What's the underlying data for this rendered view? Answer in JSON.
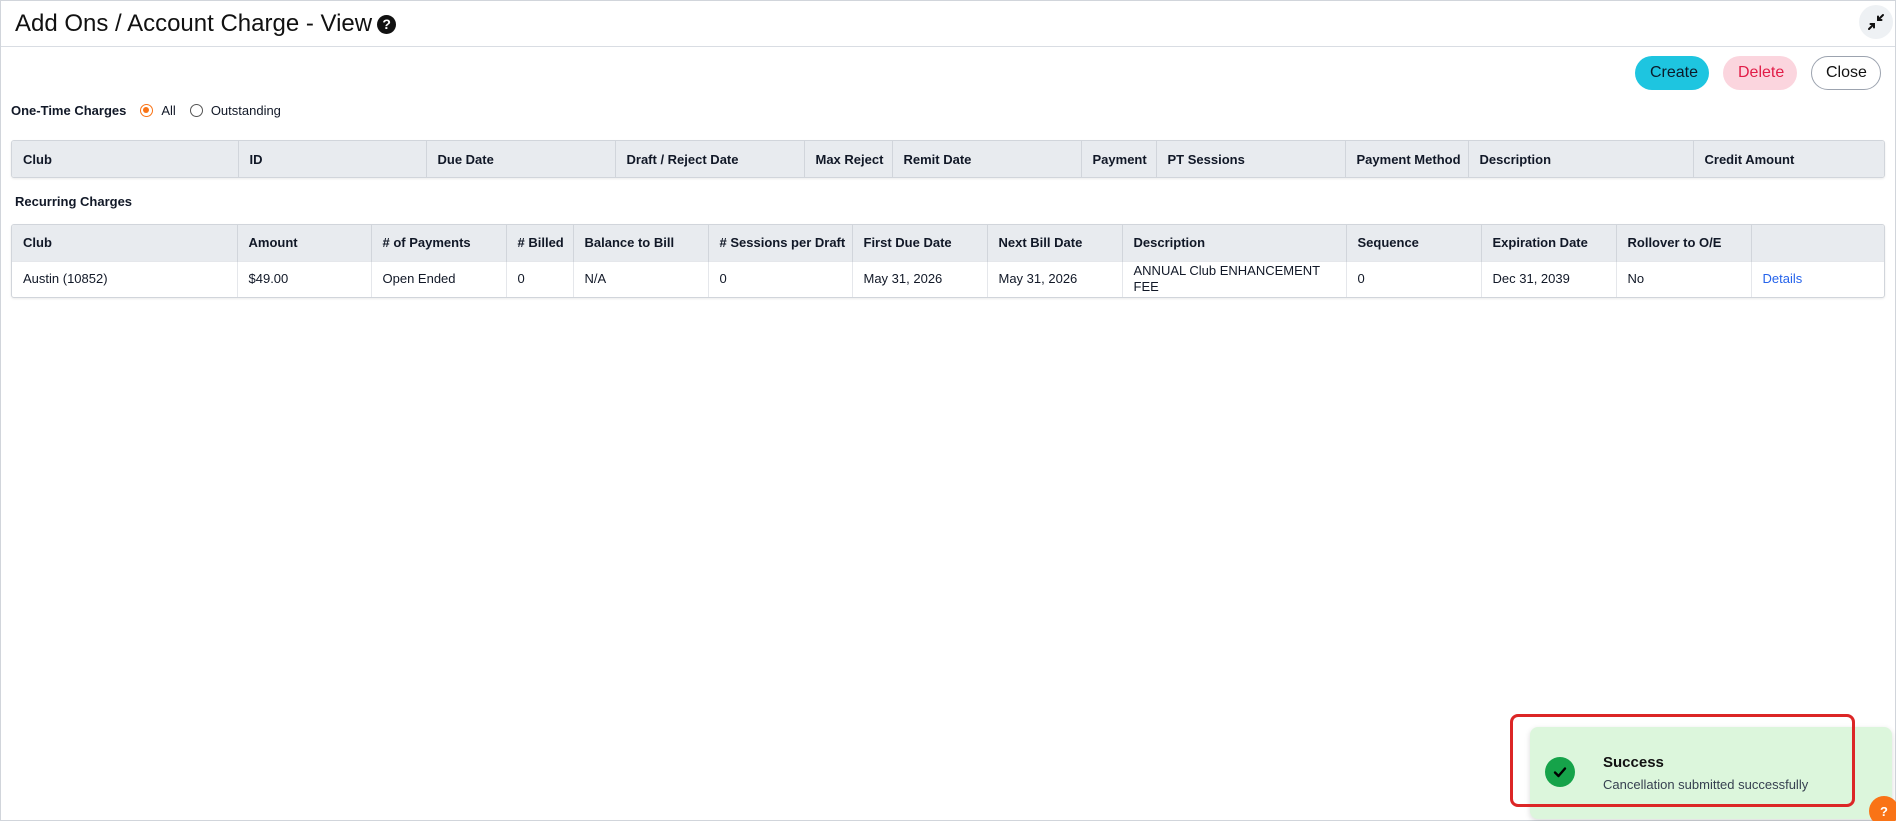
{
  "header": {
    "title": "Add Ons / Account Charge - View",
    "help_icon": "?"
  },
  "toolbar": {
    "create_label": "Create",
    "delete_label": "Delete",
    "close_label": "Close"
  },
  "one_time": {
    "label": "One-Time Charges",
    "filters": [
      {
        "label": "All",
        "checked": true
      },
      {
        "label": "Outstanding",
        "checked": false
      }
    ],
    "columns": [
      "Club",
      "ID",
      "Due Date",
      "Draft / Reject Date",
      "Max Reject",
      "Remit Date",
      "Payment",
      "PT Sessions",
      "Payment Method",
      "Description",
      "Credit Amount"
    ]
  },
  "recurring": {
    "label": "Recurring Charges",
    "columns": [
      "Club",
      "Amount",
      "# of Payments",
      "# Billed",
      "Balance to Bill",
      "# Sessions per Draft",
      "First Due Date",
      "Next Bill Date",
      "Description",
      "Sequence",
      "Expiration Date",
      "Rollover to O/E",
      ""
    ],
    "rows": [
      {
        "club": "Austin (10852)",
        "amount": "$49.00",
        "payments": "Open Ended",
        "billed": "0",
        "balance": "N/A",
        "sessions": "0",
        "first_due": "May 31, 2026",
        "next_bill": "May 31, 2026",
        "description": "ANNUAL Club ENHANCEMENT FEE",
        "sequence": "0",
        "expiration": "Dec 31, 2039",
        "rollover": "No",
        "details": "Details"
      }
    ]
  },
  "toast": {
    "title": "Success",
    "message": "Cancellation submitted successfully"
  },
  "help_fab": "?",
  "colors": {
    "accent_create": "#1ec5e0",
    "accent_delete": "#e11d48",
    "radio_checked": "#f97316",
    "success": "#16a34a",
    "highlight": "#dc2626"
  }
}
